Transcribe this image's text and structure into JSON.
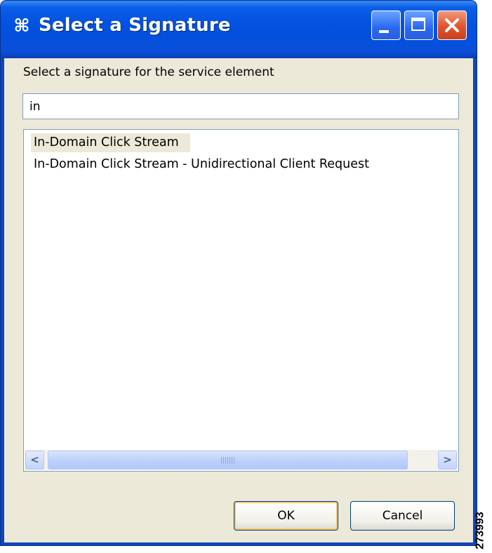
{
  "window": {
    "title": "Select a Signature",
    "app_icon": "signature-app-icon"
  },
  "dialog": {
    "prompt": "Select a signature for the service element",
    "search_value": "in",
    "results": [
      {
        "label": "In-Domain Click Stream",
        "selected": true
      },
      {
        "label": "In-Domain Click Stream - Unidirectional Client Request",
        "selected": false
      }
    ],
    "scrollbar": {
      "left_arrow": "<",
      "right_arrow": ">"
    },
    "buttons": {
      "ok": "OK",
      "cancel": "Cancel"
    }
  },
  "figure_id": "273993",
  "colors": {
    "titlebar": "#0450dc",
    "dialog_bg": "#ece9d8",
    "close_button": "#e0542c",
    "input_border": "#7f9db9"
  }
}
